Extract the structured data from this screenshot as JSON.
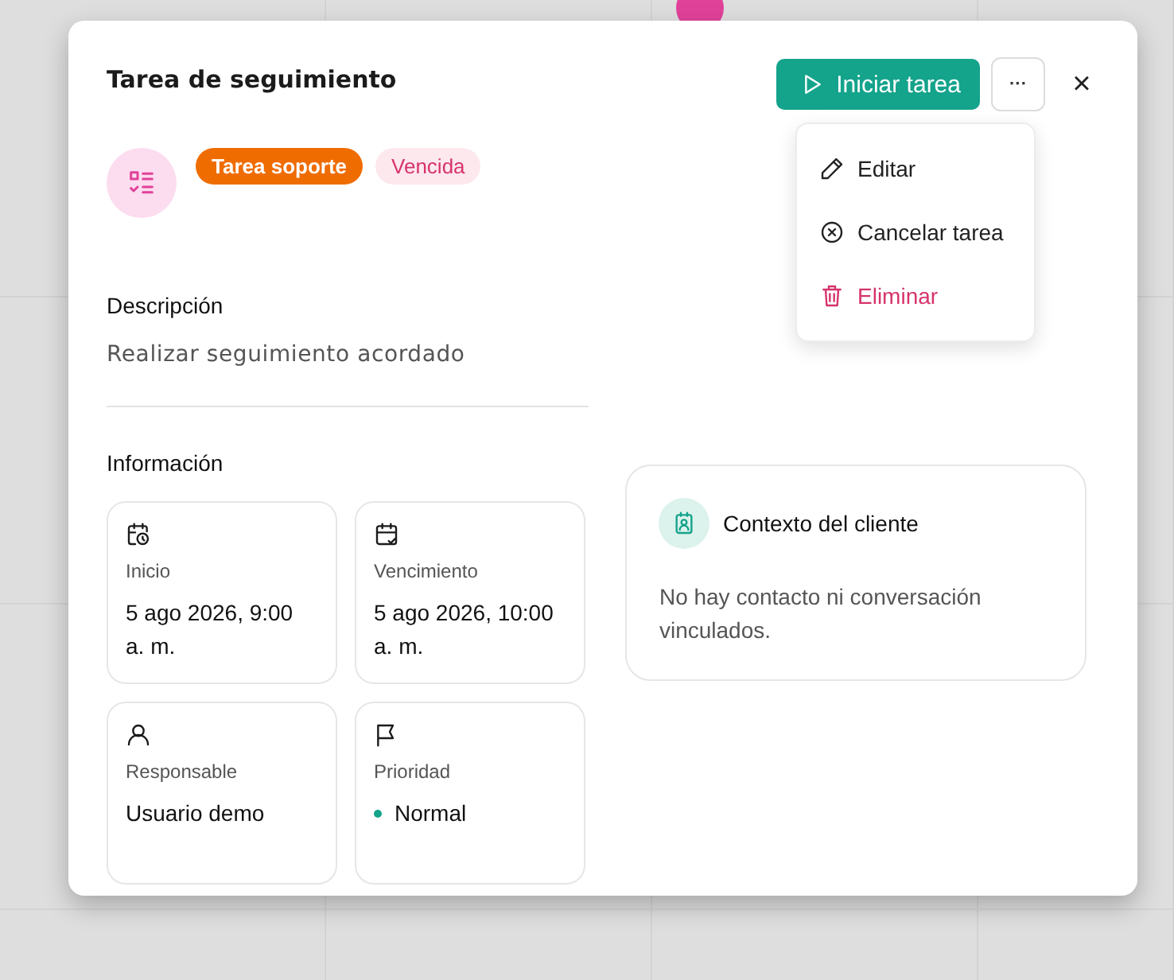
{
  "dialog": {
    "title": "Tarea de seguimiento",
    "start_button": "Iniciar tarea",
    "more_button": "···",
    "close_button": "×",
    "menu": [
      {
        "label": "Editar",
        "kind": "edit"
      },
      {
        "label": "Cancelar tarea",
        "kind": "cancel"
      },
      {
        "label": "Eliminar",
        "kind": "delete"
      }
    ],
    "tags": [
      {
        "label": "Tarea soporte",
        "kind": "category"
      },
      {
        "label": "Vencida",
        "kind": "status"
      }
    ],
    "description": {
      "heading": "Descripción",
      "text": "Realizar seguimiento acordado"
    },
    "information": {
      "heading": "Información",
      "cards": [
        {
          "kind": "start",
          "label": "Inicio",
          "value": "5 ago 2026, 9:00 a. m."
        },
        {
          "kind": "due",
          "label": "Vencimiento",
          "value": "5 ago 2026, 10:00 a. m."
        },
        {
          "kind": "owner",
          "label": "Responsable",
          "value": "Usuario demo"
        },
        {
          "kind": "priority",
          "label": "Prioridad",
          "value": "Normal",
          "color": "#14a38b"
        }
      ]
    },
    "client_context": {
      "title": "Contexto del cliente",
      "text": "No hay contacto ni conversación vinculados."
    }
  }
}
